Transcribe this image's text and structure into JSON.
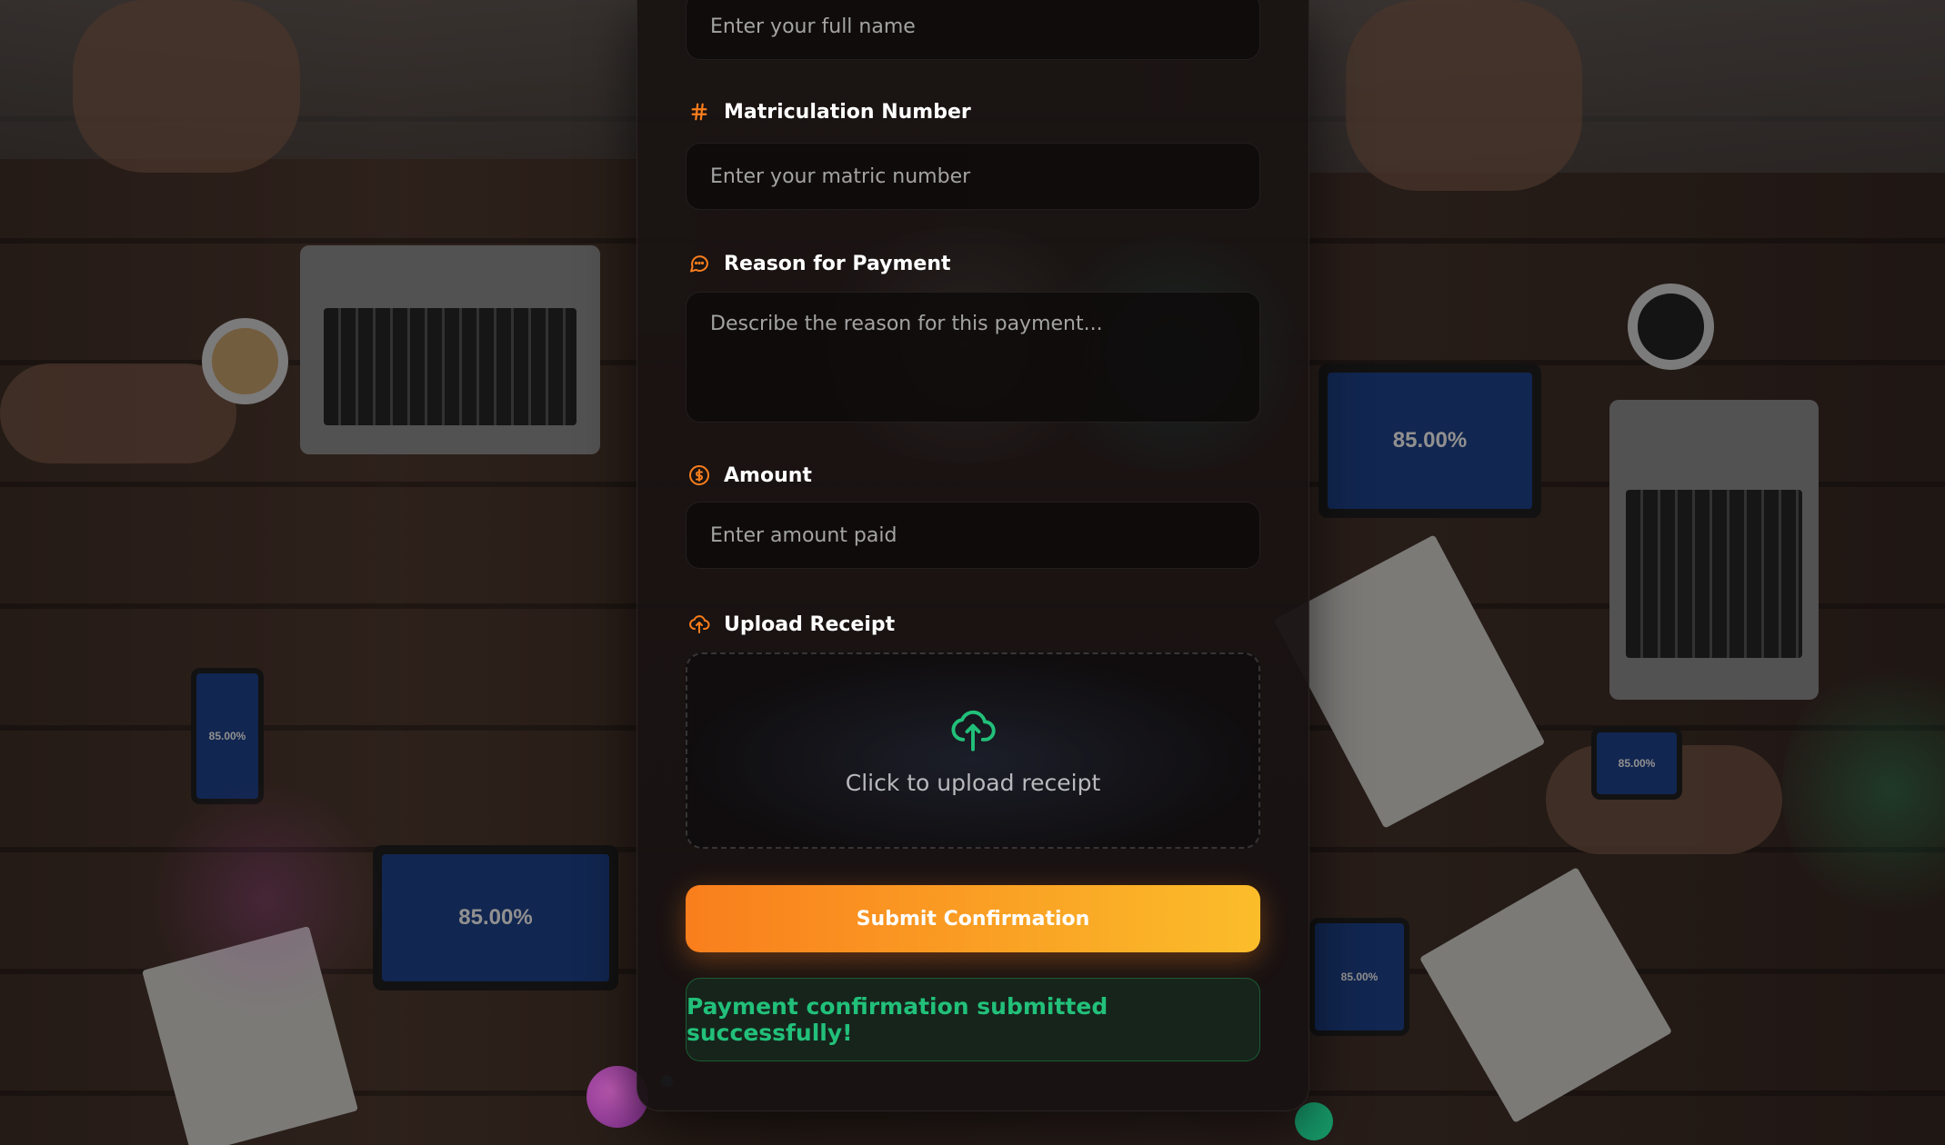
{
  "form": {
    "full_name": {
      "placeholder": "Enter your full name"
    },
    "matric": {
      "label": "Matriculation Number",
      "placeholder": "Enter your matric number",
      "icon": "hash-icon"
    },
    "reason": {
      "label": "Reason for Payment",
      "placeholder": "Describe the reason for this payment...",
      "icon": "message-icon"
    },
    "amount": {
      "label": "Amount",
      "placeholder": "Enter amount paid",
      "icon": "dollar-circle-icon"
    },
    "receipt": {
      "label": "Upload Receipt",
      "icon": "upload-cloud-icon",
      "dropzone_text": "Click to upload receipt"
    },
    "submit_label": "Submit Confirmation",
    "success_message": "Payment confirmation submitted successfully!"
  },
  "background": {
    "tablet_texts": [
      "85.00%",
      "85.00%",
      "85.00%",
      "85.00%",
      "85.00%"
    ]
  },
  "colors": {
    "accent": "#f97e1d",
    "accent_end": "#fbbd2a",
    "success": "#22c07a",
    "upload_icon": "#22c07a"
  }
}
